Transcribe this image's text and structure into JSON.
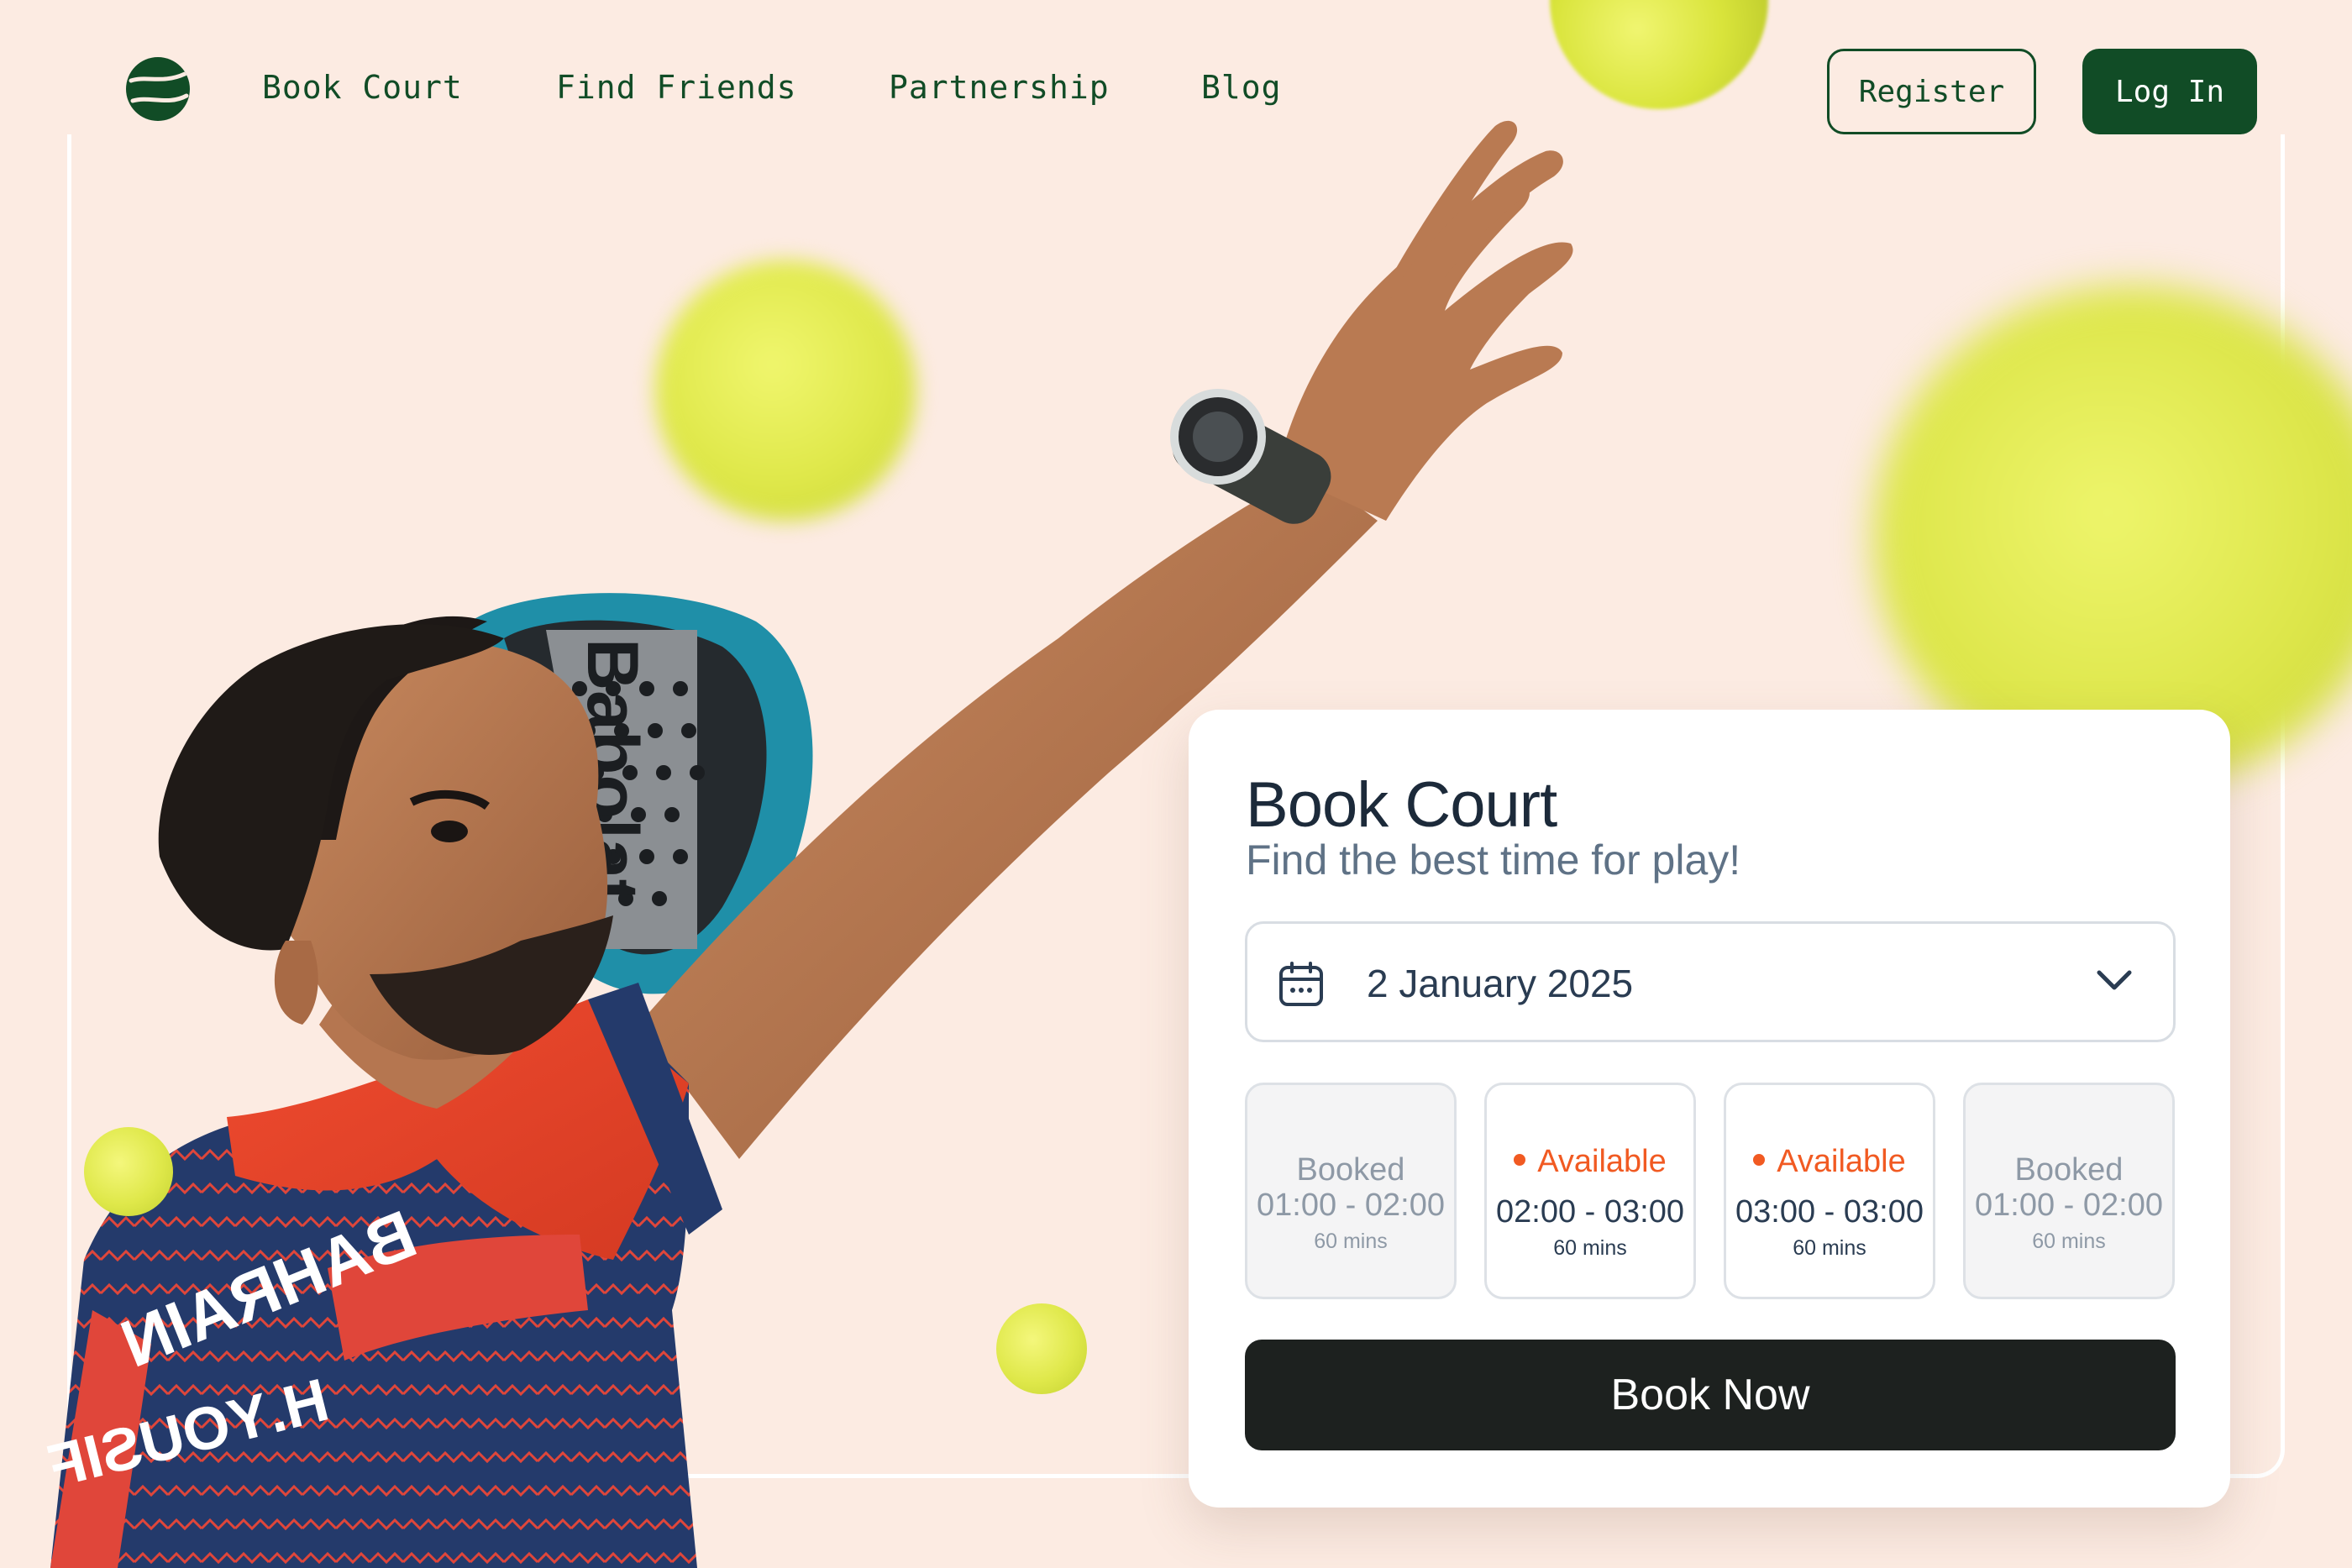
{
  "nav": {
    "links": [
      "Book Court",
      "Find Friends",
      "Partnership",
      "Blog"
    ],
    "register_label": "Register",
    "login_label": "Log In"
  },
  "booking": {
    "title": "Book Court",
    "subtitle": "Find the best time for play!",
    "date": "2 January 2025",
    "slots": [
      {
        "status": "Booked",
        "time": "01:00 - 02:00",
        "duration": "60 mins"
      },
      {
        "status": "Available",
        "time": "02:00 - 03:00",
        "duration": "60 mins"
      },
      {
        "status": "Available",
        "time": "03:00 - 03:00",
        "duration": "60 mins"
      },
      {
        "status": "Booked",
        "time": "01:00 - 02:00",
        "duration": "60 mins"
      }
    ],
    "cta_label": "Book Now"
  },
  "hero": {
    "jersey_text_1": "BAHRAIN",
    "jersey_text_2": "H.YOUSIF",
    "racket_brand": "Babolat"
  },
  "colors": {
    "background": "#fcebe2",
    "brand_green": "#114c26",
    "available_orange": "#f15a22",
    "cta_dark": "#1d211f"
  }
}
